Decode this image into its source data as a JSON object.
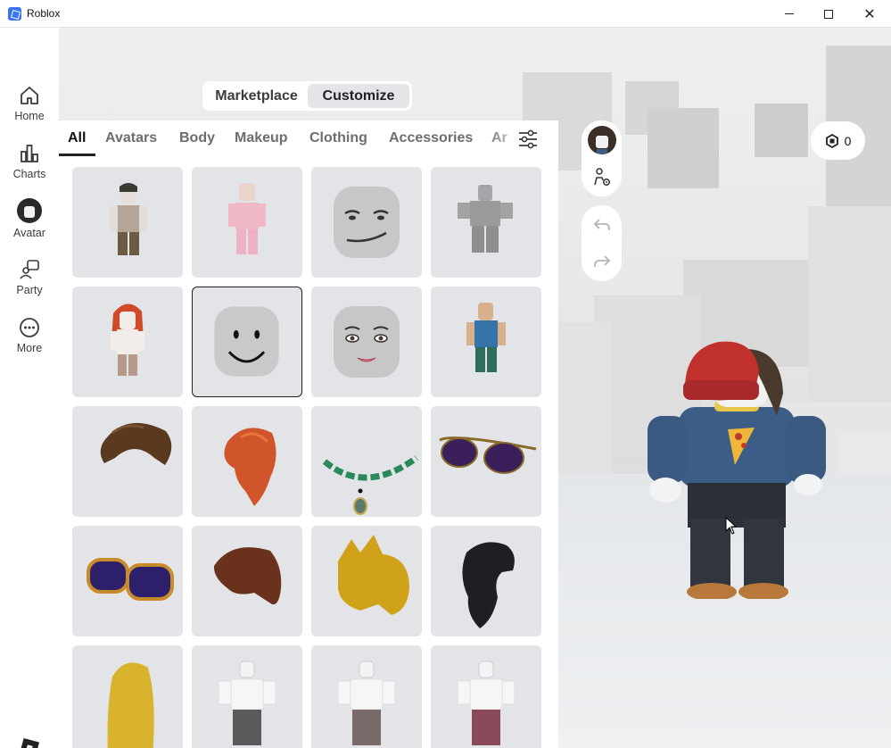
{
  "window": {
    "title": "Roblox"
  },
  "nav": {
    "items": [
      {
        "label": "Home",
        "icon": "home-icon"
      },
      {
        "label": "Charts",
        "icon": "charts-icon"
      },
      {
        "label": "Avatar",
        "icon": "avatar-icon"
      },
      {
        "label": "Party",
        "icon": "party-icon"
      },
      {
        "label": "More",
        "icon": "more-icon"
      }
    ]
  },
  "segment": {
    "marketplace": "Marketplace",
    "customize": "Customize",
    "selected": "Customize"
  },
  "tabs": [
    {
      "label": "All",
      "active": true
    },
    {
      "label": "Avatars"
    },
    {
      "label": "Body"
    },
    {
      "label": "Makeup"
    },
    {
      "label": "Clothing"
    },
    {
      "label": "Accessories"
    },
    {
      "label": "Ar"
    }
  ],
  "robux": {
    "balance": "0"
  },
  "items": [
    "avatar-brown-shirt",
    "avatar-pink",
    "face-smirk",
    "avatar-gray-blocky",
    "avatar-red-hair",
    "face-smile",
    "face-woman",
    "avatar-blue-shirt",
    "hair-brown",
    "hair-orange",
    "necklace-green",
    "sunglasses-purple",
    "sunglasses-orange",
    "hair-brown-messy",
    "hair-golden",
    "hair-black",
    "hair-blonde",
    "avatar-white-1",
    "avatar-white-2",
    "avatar-white-3"
  ],
  "selected_item": "face-smile"
}
